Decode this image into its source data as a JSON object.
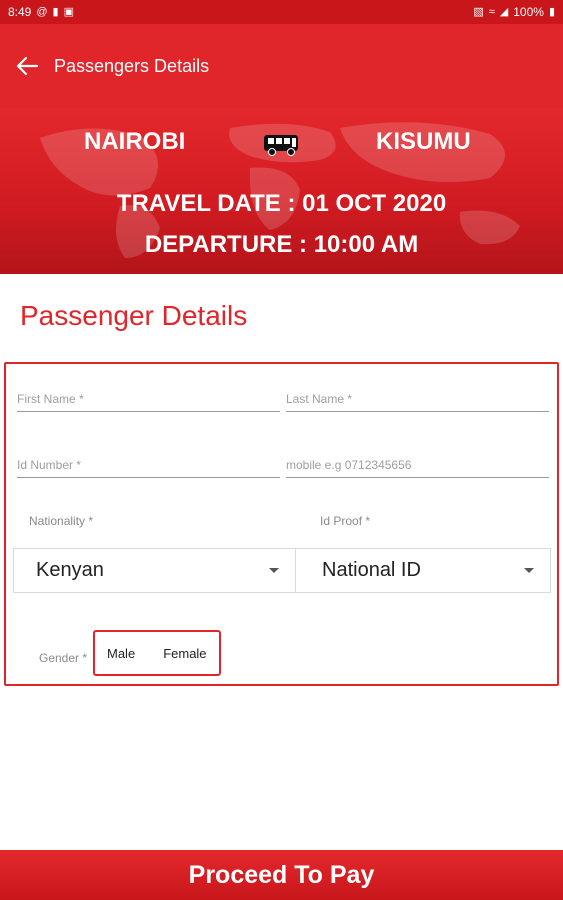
{
  "status_bar": {
    "time": "8:49",
    "battery": "100%",
    "left_icons": [
      "at-sign-icon",
      "message-icon",
      "app-notification-icon"
    ],
    "right_icons": [
      "vibrate-icon",
      "wifi-icon",
      "signal-icon",
      "battery-icon"
    ]
  },
  "app_bar": {
    "title": "Passengers Details",
    "back_icon": "arrow-left-icon"
  },
  "trip": {
    "from": "NAIROBI",
    "to": "KISUMU",
    "travel_date": "TRAVEL DATE : 01 OCT 2020",
    "departure": "DEPARTURE : 10:00 AM",
    "vehicle_icon": "bus-icon"
  },
  "section_title": "Passenger Details",
  "form": {
    "first_name_placeholder": "First Name *",
    "last_name_placeholder": "Last Name *",
    "id_number_placeholder": "Id Number *",
    "mobile_placeholder": "mobile e.g 0712345656",
    "nationality_label": "Nationality *",
    "nationality_value": "Kenyan",
    "id_proof_label": "Id Proof *",
    "id_proof_value": "National ID",
    "gender_label": "Gender *",
    "gender_options": [
      "Male",
      "Female"
    ]
  },
  "proceed_label": "Proceed To Pay",
  "colors": {
    "primary": "#e0262a",
    "dark_primary": "#c8161b"
  }
}
